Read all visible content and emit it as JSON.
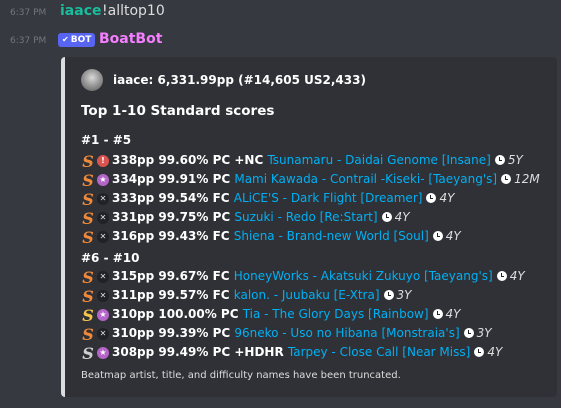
{
  "messages": [
    {
      "time": "6:37 PM",
      "author": "iaace",
      "text": "!alltop10"
    },
    {
      "time": "6:37 PM",
      "badge": "BOT",
      "author": "BoatBot"
    }
  ],
  "embed": {
    "author": "iaace: 6,331.99pp (#14,605 US2,433)",
    "title": "Top 1-10 Standard scores",
    "fields": [
      {
        "name": "#1 - #5",
        "rows": [
          {
            "grade": "S",
            "grade_color": "#f08a3a",
            "mod_icon": "gold-star",
            "stats": "338pp 99.60% PC +NC",
            "link": "Tsunamaru - Daidai Genome [Insane]",
            "age": "5Y"
          },
          {
            "grade": "S",
            "grade_color": "#f08a3a",
            "mod_icon": "pink-star",
            "stats": "334pp 99.91% PC",
            "link": "Mami Kawada - Contrail -Kiseki- [Taeyang's]",
            "age": "12M"
          },
          {
            "grade": "S",
            "grade_color": "#f08a3a",
            "mod_icon": "cross",
            "stats": "333pp 99.54% FC",
            "link": "ALiCE'S - Dark Flight [Dreamer]",
            "age": "4Y"
          },
          {
            "grade": "S",
            "grade_color": "#f08a3a",
            "mod_icon": "cross",
            "stats": "331pp 99.75% PC",
            "link": "Suzuki - Redo [Re:Start]",
            "age": "4Y"
          },
          {
            "grade": "S",
            "grade_color": "#f08a3a",
            "mod_icon": "cross",
            "stats": "316pp 99.43% FC",
            "link": "Shiena - Brand-new World [Soul]",
            "age": "4Y"
          }
        ]
      },
      {
        "name": "#6 - #10",
        "rows": [
          {
            "grade": "S",
            "grade_color": "#f08a3a",
            "mod_icon": "cross",
            "stats": "315pp 99.67% FC",
            "link": "HoneyWorks - Akatsuki Zukuyo [Taeyang's]",
            "age": "4Y"
          },
          {
            "grade": "S",
            "grade_color": "#f08a3a",
            "mod_icon": "cross",
            "stats": "311pp 99.57% FC",
            "link": "kalon. - Juubaku [E-Xtra]",
            "age": "3Y"
          },
          {
            "grade": "S",
            "grade_color": "#f5c54b",
            "mod_icon": "pink-star",
            "stats": "310pp 100.00% PC",
            "link": "Tia - The Glory Days [Rainbow]",
            "age": "4Y"
          },
          {
            "grade": "S",
            "grade_color": "#f08a3a",
            "mod_icon": "cross",
            "stats": "310pp 99.39% PC",
            "link": "96neko - Uso no Hibana [Monstraia's]",
            "age": "3Y"
          },
          {
            "grade": "S",
            "grade_color": "#d0d0d0",
            "mod_icon": "pink-star",
            "stats": "308pp 99.49% PC +HDHR",
            "link": "Tarpey - Close Call [Near Miss]",
            "age": "4Y"
          }
        ]
      }
    ],
    "footer": "Beatmap artist, title, and difficulty names have been truncated."
  }
}
